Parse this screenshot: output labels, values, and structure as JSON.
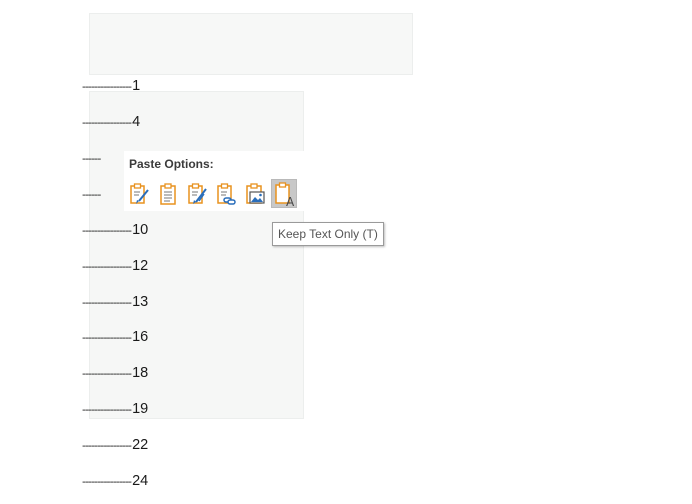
{
  "document": {
    "lines": [
      {
        "dashes": "----------------",
        "number": "1"
      },
      {
        "dashes": "----------------",
        "number": "4"
      },
      {
        "dashes": "------",
        "number": ""
      },
      {
        "dashes": "------",
        "number": ""
      },
      {
        "dashes": "----------------",
        "number": "10"
      },
      {
        "dashes": "----------------",
        "number": "12"
      },
      {
        "dashes": "----------------",
        "number": "13"
      },
      {
        "dashes": "----------------",
        "number": "16"
      },
      {
        "dashes": "----------------",
        "number": "18"
      },
      {
        "dashes": "----------------",
        "number": "19"
      },
      {
        "dashes": "----------------",
        "number": "22"
      },
      {
        "dashes": "----------------",
        "number": "24"
      }
    ]
  },
  "paste_options": {
    "title": "Paste Options:",
    "icons": [
      {
        "name": "keep-source-formatting-icon",
        "tooltip": "Keep Source Formatting"
      },
      {
        "name": "use-destination-styles-icon",
        "tooltip": "Use Destination Styles"
      },
      {
        "name": "merge-formatting-icon",
        "tooltip": "Merge Formatting"
      },
      {
        "name": "link-paste-icon",
        "tooltip": "Link"
      },
      {
        "name": "picture-paste-icon",
        "tooltip": "Picture"
      },
      {
        "name": "keep-text-only-icon",
        "tooltip": "Keep Text Only (T)",
        "selected": true
      }
    ],
    "tooltip": "Keep Text Only (T)"
  },
  "colors": {
    "clipboard_orange": "#e8921f",
    "brush_blue": "#2a6ebb",
    "selection_gray": "#c8c8c8"
  }
}
